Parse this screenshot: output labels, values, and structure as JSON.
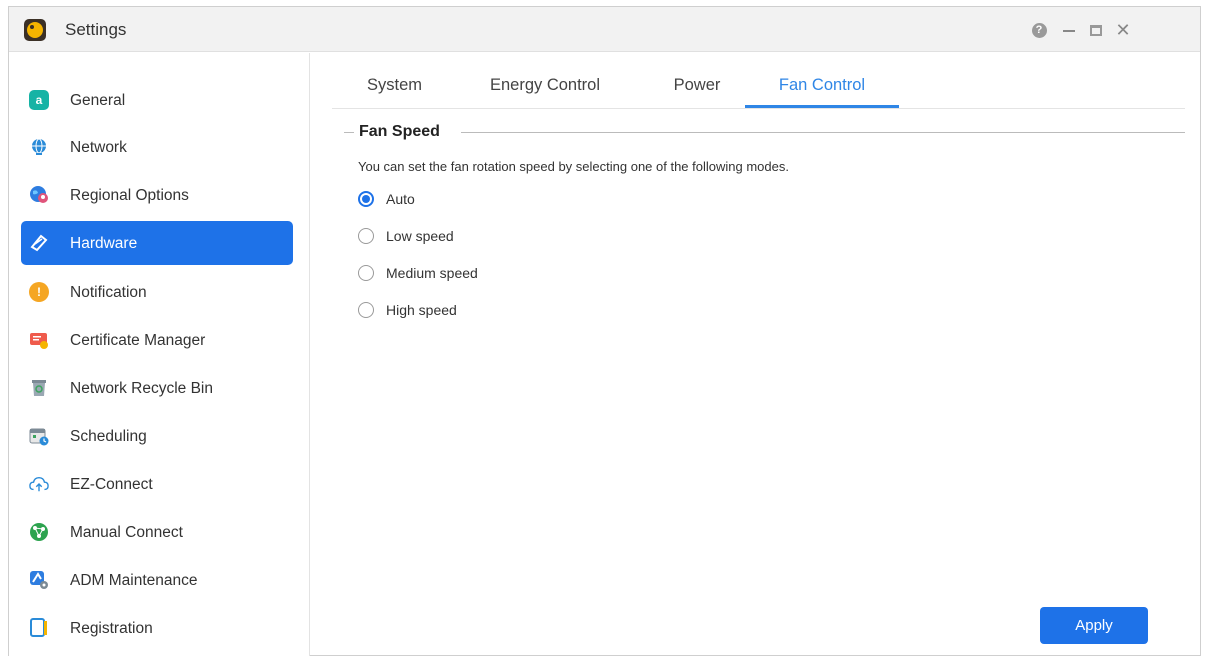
{
  "window": {
    "title": "Settings",
    "help_glyph": "?",
    "close_glyph": "✕"
  },
  "sidebar": {
    "items": [
      {
        "label": "General",
        "icon": "general-icon",
        "glyph": "a",
        "color": "#16b3a5"
      },
      {
        "label": "Network",
        "icon": "globe-icon",
        "glyph": "",
        "color": "#2a8bd8"
      },
      {
        "label": "Regional Options",
        "icon": "regional-options-icon",
        "glyph": "",
        "color": "#2e7de0"
      },
      {
        "label": "Hardware",
        "icon": "hardware-icon",
        "glyph": "",
        "color": "#ffffff"
      },
      {
        "label": "Notification",
        "icon": "notification-icon",
        "glyph": "!",
        "color": "#f5a623"
      },
      {
        "label": "Certificate Manager",
        "icon": "certificate-icon",
        "glyph": "",
        "color": "#ef5b4c"
      },
      {
        "label": "Network Recycle Bin",
        "icon": "recycle-bin-icon",
        "glyph": "",
        "color": "#7c8a95"
      },
      {
        "label": "Scheduling",
        "icon": "scheduling-icon",
        "glyph": "",
        "color": "#3ca35f"
      },
      {
        "label": "EZ-Connect",
        "icon": "cloud-upload-icon",
        "glyph": "",
        "color": "#2a8bd8"
      },
      {
        "label": "Manual Connect",
        "icon": "manual-connect-icon",
        "glyph": "",
        "color": "#2da34f"
      },
      {
        "label": "ADM Maintenance",
        "icon": "adm-maintenance-icon",
        "glyph": "",
        "color": "#2e7de0"
      },
      {
        "label": "Registration",
        "icon": "registration-icon",
        "glyph": "",
        "color": "#2a8bd8"
      }
    ],
    "active_index": 3
  },
  "tabs": [
    {
      "label": "System",
      "active": false
    },
    {
      "label": "Energy Control",
      "active": false
    },
    {
      "label": "Power",
      "active": false
    },
    {
      "label": "Fan Control",
      "active": true
    }
  ],
  "fan_speed": {
    "legend": "Fan Speed",
    "description": "You can set the fan rotation speed by selecting one of the following modes.",
    "options": [
      {
        "label": "Auto",
        "checked": true
      },
      {
        "label": "Low speed",
        "checked": false
      },
      {
        "label": "Medium speed",
        "checked": false
      },
      {
        "label": "High speed",
        "checked": false
      }
    ]
  },
  "apply_label": "Apply",
  "colors": {
    "accent": "#1e72e8",
    "tab_active": "#2f86e6"
  }
}
